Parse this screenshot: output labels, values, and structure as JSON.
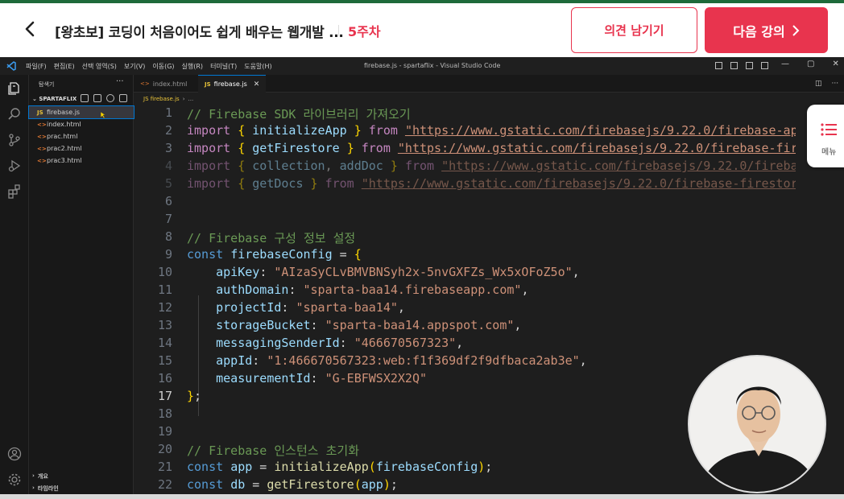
{
  "header": {
    "course_title": "[왕초보] 코딩이 처음이어도 쉽게 배우는 웹개발 ...",
    "week": "5주차",
    "feedback_button": "의견 남기기",
    "next_button": "다음 강의",
    "accent_color": "#e8344e"
  },
  "vscode": {
    "menu": [
      "파일(F)",
      "편집(E)",
      "선택 영역(S)",
      "보기(V)",
      "이동(G)",
      "실행(R)",
      "터미널(T)",
      "도움말(H)"
    ],
    "window_title": "firebase.js - spartaflix - Visual Studio Code",
    "sidebar_title": "탐색기",
    "project": "SPARTAFLIX",
    "files": [
      {
        "name": "firebase.js",
        "type": "JS"
      },
      {
        "name": "index.html",
        "type": "html"
      },
      {
        "name": "prac.html",
        "type": "html"
      },
      {
        "name": "prac2.html",
        "type": "html"
      },
      {
        "name": "prac3.html",
        "type": "html"
      }
    ],
    "outline": "개요",
    "timeline": "타임라인",
    "tabs": [
      {
        "name": "index.html",
        "type": "html"
      },
      {
        "name": "firebase.js",
        "type": "JS"
      }
    ],
    "breadcrumb": [
      "JS firebase.js",
      "..."
    ]
  },
  "code": {
    "line1": "// Firebase SDK 라이브러리 가져오기",
    "line2_url": "\"https://www.gstatic.com/firebasejs/9.22.0/firebase-ap",
    "line3_url": "\"https://www.gstatic.com/firebasejs/9.22.0/firebase-fir",
    "line4_url": "\"https://www.gstatic.com/firebasejs/9.22.0/fireba",
    "line5_url": "\"https://www.gstatic.com/firebasejs/9.22.0/firebase-firestor",
    "line8": "// Firebase 구성 정보 설정",
    "apiKey": "\"AIzaSyCLvBMVBNSyh2x-5nvGXFZs_Wx5xOFoZ5o\"",
    "authDomain": "\"sparta-baa14.firebaseapp.com\"",
    "projectId": "\"sparta-baa14\"",
    "storageBucket": "\"sparta-baa14.appspot.com\"",
    "messagingSenderId": "\"466670567323\"",
    "appId": "\"1:466670567323:web:f1f369df2f9dfbaca2ab3e\"",
    "measurementId": "\"G-EBFWSX2X2Q\"",
    "line20": "// Firebase 인스턴스 초기화"
  },
  "menu_float_label": "메뉴"
}
